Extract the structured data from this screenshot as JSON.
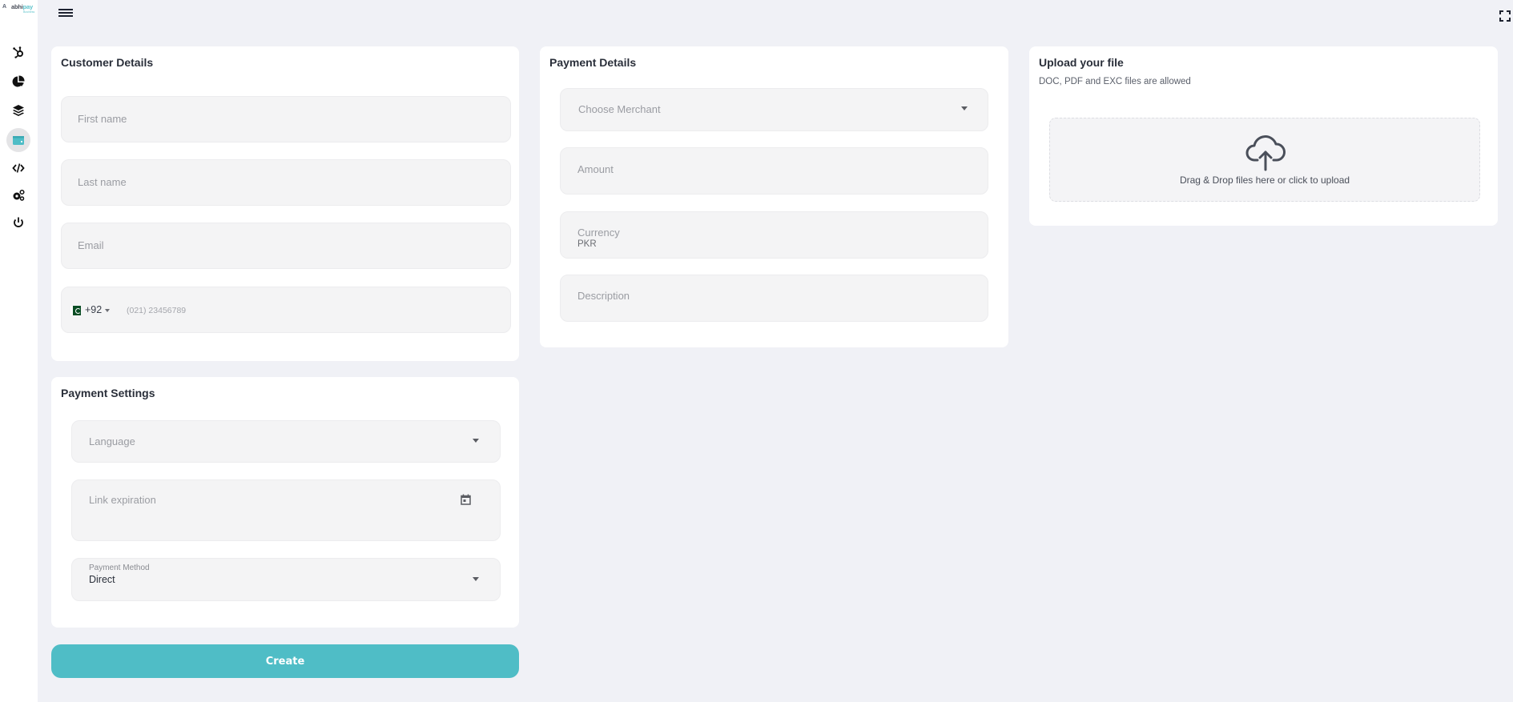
{
  "app": {
    "logo_mark": "A",
    "logo_name_part1": "abhi",
    "logo_name_part2": "pay",
    "logo_sub": "Business"
  },
  "sidebar": {
    "items": [
      {
        "icon": "hubspot-icon",
        "label": "Integrations"
      },
      {
        "icon": "pie-chart-icon",
        "label": "Dashboard"
      },
      {
        "icon": "layers-icon",
        "label": "Layers"
      },
      {
        "icon": "wallet-icon",
        "label": "Payments",
        "active": true
      },
      {
        "icon": "code-icon",
        "label": "Developers"
      },
      {
        "icon": "gears-icon",
        "label": "Settings"
      },
      {
        "icon": "power-icon",
        "label": "Logout"
      }
    ]
  },
  "topbar": {
    "menu_icon": "hamburger-icon",
    "fullscreen_icon": "fullscreen-icon"
  },
  "customer_details": {
    "title": "Customer Details",
    "first_name_placeholder": "First name",
    "last_name_placeholder": "Last name",
    "email_placeholder": "Email",
    "phone": {
      "country_code": "+92",
      "country_flag": "Pakistan",
      "placeholder": "(021) 23456789"
    }
  },
  "payment_settings": {
    "title": "Payment Settings",
    "language_placeholder": "Language",
    "link_expiration_placeholder": "Link expiration",
    "payment_method_label": "Payment Method",
    "payment_method_value": "Direct"
  },
  "payment_details": {
    "title": "Payment Details",
    "merchant_placeholder": "Choose Merchant",
    "amount_placeholder": "Amount",
    "currency_label": "Currency",
    "currency_value": "PKR",
    "description_placeholder": "Description"
  },
  "upload": {
    "title": "Upload your file",
    "subtitle": "DOC, PDF and EXC files are allowed",
    "dropzone_text": "Drag & Drop files here or click to upload"
  },
  "actions": {
    "create_label": "Create"
  },
  "colors": {
    "accent": "#4fbdc6",
    "background": "#f0f1f6",
    "card": "#ffffff",
    "field": "#f4f4f5"
  }
}
